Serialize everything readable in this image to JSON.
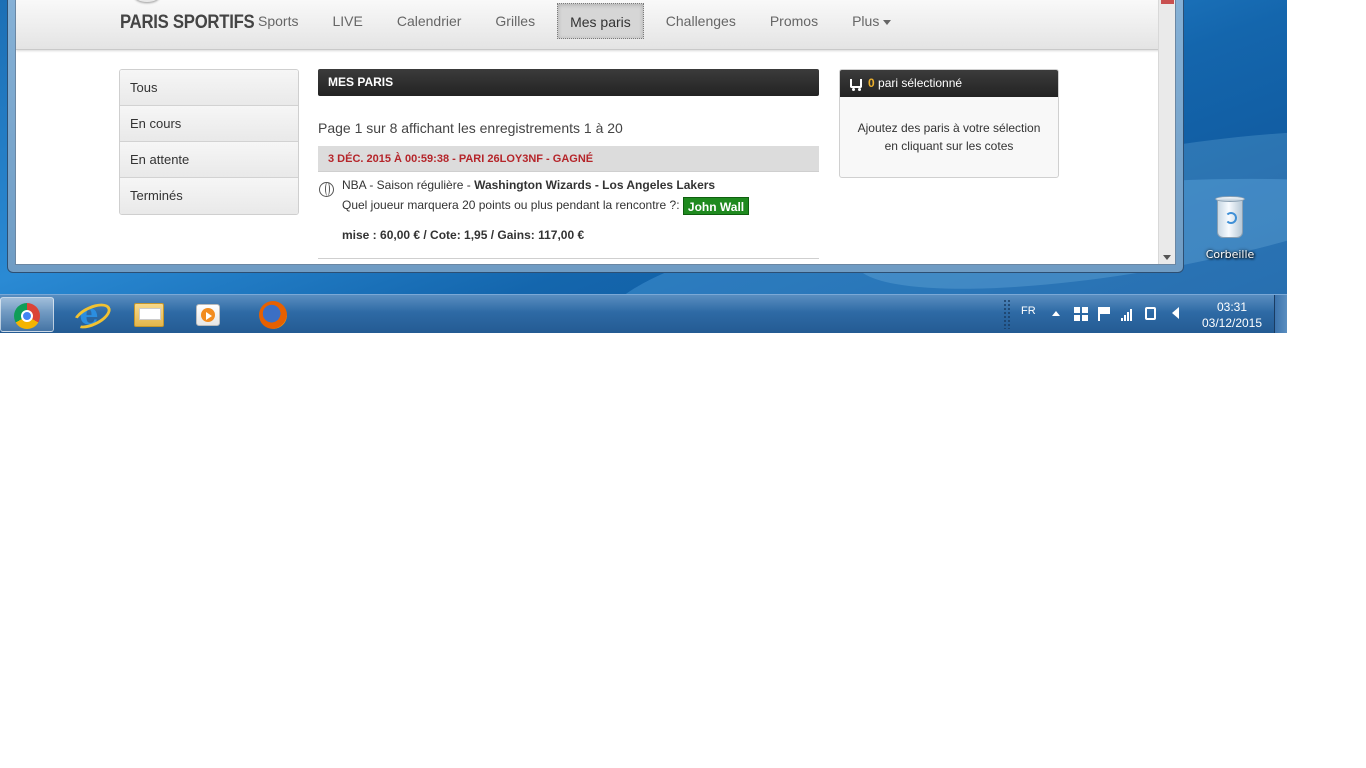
{
  "browser": {
    "site": {
      "brand": "PARIS SPORTIFS",
      "nav": [
        {
          "label": "Sports"
        },
        {
          "label": "LIVE"
        },
        {
          "label": "Calendrier"
        },
        {
          "label": "Grilles"
        },
        {
          "label": "Mes paris",
          "active": true
        },
        {
          "label": "Challenges"
        },
        {
          "label": "Promos"
        },
        {
          "label": "Plus"
        }
      ],
      "side_menu": [
        "Tous",
        "En cours",
        "En attente",
        "Terminés"
      ],
      "main": {
        "title": "MES PARIS",
        "pager": "Page 1 sur 8 affichant les enregistrements 1 à 20",
        "bet": {
          "header": "3 DÉC. 2015 À 00:59:38 - PARI 26LOY3NF - GAGNÉ",
          "sport_icon": "basketball-icon",
          "competition": "NBA - Saison régulière - ",
          "teams": "Washington Wizards - Los Angeles Lakers",
          "question": "Quel joueur marquera 20 points ou plus pendant la rencontre ?: ",
          "selection": "John Wall",
          "stake_line": "mise : 60,00 € / Cote: 1,95 / Gains: 117,00 €"
        }
      },
      "bet_slip": {
        "count": "0",
        "title": " pari sélectionné",
        "message": "Ajoutez des paris à votre sélection en cliquant sur les cotes"
      }
    }
  },
  "desktop": {
    "recycle_bin_label": "Corbeille"
  },
  "taskbar": {
    "apps": [
      "chrome-icon",
      "internet-explorer-icon",
      "file-explorer-icon",
      "media-player-icon",
      "firefox-icon"
    ],
    "language": "FR",
    "clock_time": "03:31",
    "clock_date": "03/12/2015"
  },
  "colors": {
    "result_red": "#b5252a",
    "selection_green": "#1f8a1f",
    "slip_count_orange": "#f0b22d"
  }
}
